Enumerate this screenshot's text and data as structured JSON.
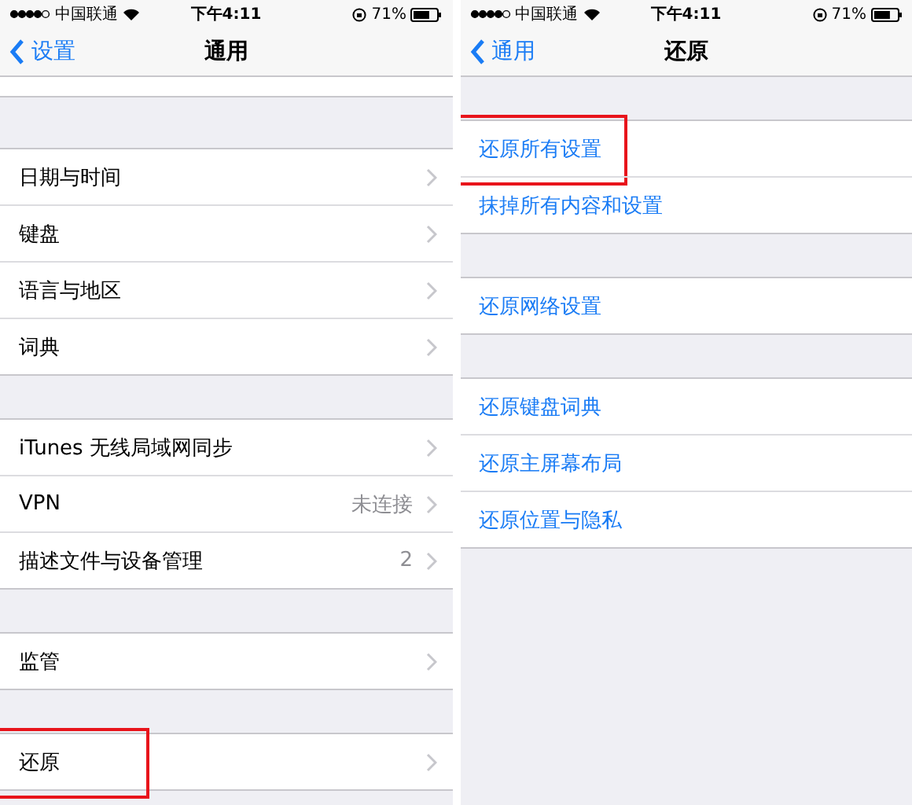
{
  "panels": [
    {
      "status_bar": {
        "carrier": "中国联通",
        "time": "下午4:11",
        "battery": "71%"
      },
      "nav": {
        "back": "设置",
        "title": "通用"
      },
      "top_row_cut": true,
      "groups": [
        {
          "rows": [
            {
              "label": "日期与时间",
              "highlighted": false
            },
            {
              "label": "键盘",
              "highlighted": false
            },
            {
              "label": "语言与地区",
              "highlighted": false
            },
            {
              "label": "词典",
              "highlighted": false
            }
          ]
        },
        {
          "rows": [
            {
              "label": "iTunes 无线局域网同步",
              "highlighted": false
            },
            {
              "label": "VPN",
              "value": "未连接",
              "highlighted": false
            },
            {
              "label": "描述文件与设备管理",
              "value": "2",
              "highlighted": false
            }
          ]
        },
        {
          "rows": [
            {
              "label": "监管",
              "highlighted": false
            }
          ]
        },
        {
          "rows": [
            {
              "label": "还原",
              "highlighted": true
            }
          ]
        }
      ],
      "kind": "disclosure"
    },
    {
      "status_bar": {
        "carrier": "中国联通",
        "time": "下午4:11",
        "battery": "71%"
      },
      "nav": {
        "back": "通用",
        "title": "还原"
      },
      "top_row_cut": false,
      "groups": [
        {
          "rows": [
            {
              "label": "还原所有设置",
              "highlighted": true
            },
            {
              "label": "抹掉所有内容和设置",
              "highlighted": false
            }
          ]
        },
        {
          "rows": [
            {
              "label": "还原网络设置",
              "highlighted": false
            }
          ]
        },
        {
          "rows": [
            {
              "label": "还原键盘词典",
              "highlighted": false
            },
            {
              "label": "还原主屏幕布局",
              "highlighted": false
            },
            {
              "label": "还原位置与隐私",
              "highlighted": false
            }
          ]
        }
      ],
      "kind": "action"
    }
  ]
}
